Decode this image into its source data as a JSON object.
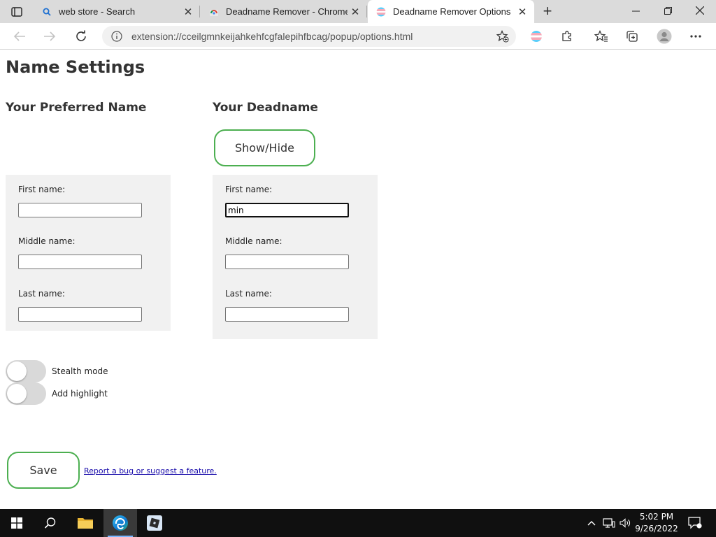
{
  "browser": {
    "tabs": [
      {
        "label": "web store - Search",
        "icon": "search-icon",
        "active": false
      },
      {
        "label": "Deadname Remover - Chrome W",
        "icon": "chrome-webstore-icon",
        "active": false
      },
      {
        "label": "Deadname Remover Options",
        "icon": "deadname-remover-icon",
        "active": true
      }
    ],
    "close_glyph": "✕",
    "new_tab_glyph": "+",
    "url": "extension://cceilgmnkeijahkehfcgfalepihfbcag/popup/options.html"
  },
  "page": {
    "title": "Name Settings",
    "preferred": {
      "heading": "Your Preferred Name",
      "first_label": "First name:",
      "first_value": "",
      "middle_label": "Middle name:",
      "middle_value": "",
      "last_label": "Last name:",
      "last_value": ""
    },
    "deadname": {
      "heading": "Your Deadname",
      "show_hide_label": "Show/Hide",
      "first_label": "First name:",
      "first_value": "min",
      "middle_label": "Middle name:",
      "middle_value": "",
      "last_label": "Last name:",
      "last_value": ""
    },
    "toggles": {
      "stealth_label": "Stealth mode",
      "stealth_on": false,
      "highlight_label": "Add highlight",
      "highlight_on": false
    },
    "save_label": "Save",
    "report_link": "Report a bug or suggest a feature."
  },
  "taskbar": {
    "time": "5:02 PM",
    "date": "9/26/2022"
  },
  "colors": {
    "accent_green": "#4caf50",
    "panel_bg": "#f1f1f1",
    "link": "#1a0dab",
    "taskbar": "#101010"
  }
}
